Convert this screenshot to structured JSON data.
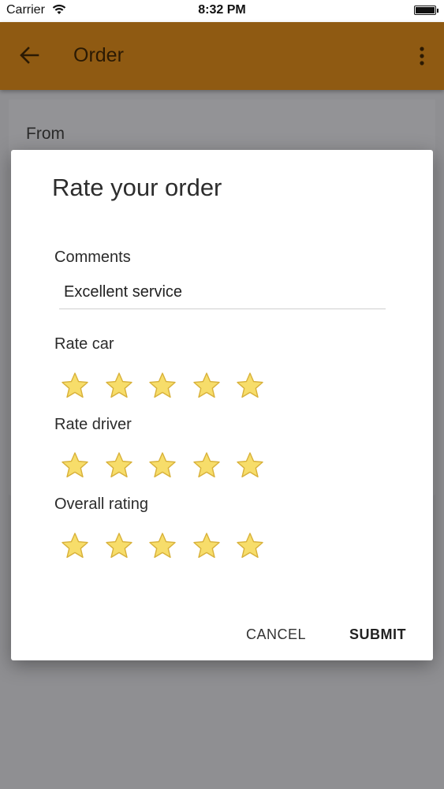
{
  "status_bar": {
    "carrier": "Carrier",
    "time": "8:32 PM"
  },
  "app_bar": {
    "title": "Order",
    "back_icon": "arrow-left-icon",
    "menu_icon": "more-vertical-icon"
  },
  "background_card": {
    "from_label": "From"
  },
  "dialog": {
    "title": "Rate your order",
    "comments_label": "Comments",
    "comments_value": "Excellent service",
    "rating_sections": [
      {
        "label": "Rate car",
        "stars_total": 5
      },
      {
        "label": "Rate driver",
        "stars_total": 5
      },
      {
        "label": "Overall rating",
        "stars_total": 5
      }
    ],
    "cancel_label": "CANCEL",
    "submit_label": "SUBMIT"
  },
  "colors": {
    "app_bar": "#8f5a12",
    "star_fill": "#f7dd6a",
    "star_stroke": "#d8b13a",
    "overlay": "#8f8f92"
  }
}
